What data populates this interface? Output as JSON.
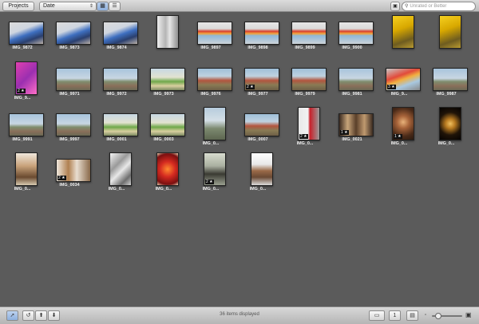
{
  "toolbar": {
    "projects_label": "Projects",
    "sort_value": "Date",
    "search_placeholder": "Unrated or Better"
  },
  "status_text": "36 items displayed",
  "photos": [
    {
      "caption": "IMG_9872",
      "scene": "kids",
      "orient": "landscape"
    },
    {
      "caption": "IMG_9873",
      "scene": "kids",
      "orient": "landscape"
    },
    {
      "caption": "IMG_9874",
      "scene": "kids",
      "orient": "landscape"
    },
    {
      "caption": "",
      "scene": "interior",
      "orient": "portrait"
    },
    {
      "caption": "IMG_9897",
      "scene": "rainbow",
      "orient": "landscape"
    },
    {
      "caption": "IMG_9898",
      "scene": "rainbow",
      "orient": "landscape"
    },
    {
      "caption": "IMG_9899",
      "scene": "rainbow",
      "orient": "landscape"
    },
    {
      "caption": "IMG_9900",
      "scene": "rainbow",
      "orient": "landscape"
    },
    {
      "caption": "",
      "scene": "yellow",
      "orient": "portrait"
    },
    {
      "caption": "",
      "scene": "yellow",
      "orient": "portrait"
    },
    {
      "caption": "IMG_9...",
      "scene": "pink",
      "orient": "portrait",
      "rating": "2 ★"
    },
    {
      "caption": "IMG_9971",
      "scene": "city",
      "orient": "landscape"
    },
    {
      "caption": "IMG_9972",
      "scene": "city",
      "orient": "landscape"
    },
    {
      "caption": "IMG_9973",
      "scene": "greenroof",
      "orient": "landscape"
    },
    {
      "caption": "IMG_9976",
      "scene": "redroofs",
      "orient": "landscape"
    },
    {
      "caption": "IMG_9977",
      "scene": "redroofs",
      "orient": "landscape",
      "rating": "2 ★"
    },
    {
      "caption": "IMG_9979",
      "scene": "redroofs",
      "orient": "landscape"
    },
    {
      "caption": "IMG_9981",
      "scene": "city",
      "orient": "landscape"
    },
    {
      "caption": "IMG_9...",
      "scene": "rainbow2",
      "orient": "landscape",
      "rating": "3 ★"
    },
    {
      "caption": "IMG_9987",
      "scene": "city",
      "orient": "landscape"
    },
    {
      "caption": "IMG_9991",
      "scene": "city",
      "orient": "landscape"
    },
    {
      "caption": "IMG_9997",
      "scene": "city",
      "orient": "landscape"
    },
    {
      "caption": "IMG_0001",
      "scene": "greenroof",
      "orient": "landscape"
    },
    {
      "caption": "IMG_0003",
      "scene": "greenroof",
      "orient": "landscape"
    },
    {
      "caption": "IMG_0...",
      "scene": "tower",
      "orient": "portrait"
    },
    {
      "caption": "IMG_0007",
      "scene": "redroofs",
      "orient": "landscape"
    },
    {
      "caption": "IMG_0...",
      "scene": "gallery",
      "orient": "portrait",
      "rating": "2 ★"
    },
    {
      "caption": "IMG_0021",
      "scene": "paintings",
      "orient": "landscape",
      "rating": "1 ★"
    },
    {
      "caption": "IMG_0...",
      "scene": "statue",
      "orient": "portrait",
      "rating": "1 ★"
    },
    {
      "caption": "IMG_0...",
      "scene": "statuedark",
      "orient": "portrait"
    },
    {
      "caption": "IMG_0...",
      "scene": "sculpture",
      "orient": "portrait"
    },
    {
      "caption": "IMG_0034",
      "scene": "gallery2",
      "orient": "landscape",
      "rating": "2 ★"
    },
    {
      "caption": "IMG_0...",
      "scene": "stairs",
      "orient": "portrait"
    },
    {
      "caption": "IMG_0...",
      "scene": "redart",
      "orient": "portrait"
    },
    {
      "caption": "IMG_0...",
      "scene": "person",
      "orient": "portrait",
      "rating": "2 ★"
    },
    {
      "caption": "IMG_0...",
      "scene": "horse",
      "orient": "portrait"
    }
  ]
}
